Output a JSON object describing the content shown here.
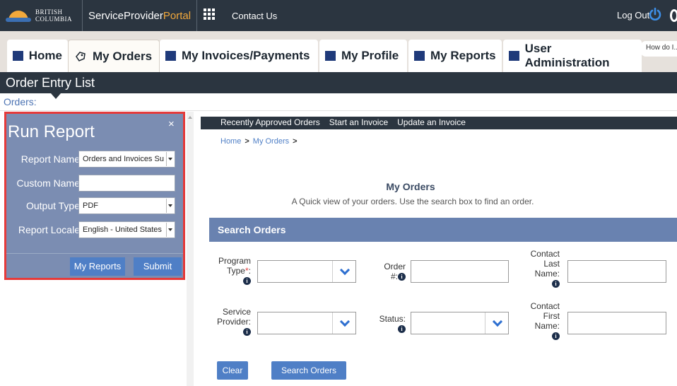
{
  "topbar": {
    "logo_line1": "BRITISH",
    "logo_line2": "COLUMBIA",
    "brand_part1": "ServiceProvider",
    "brand_part2": "Portal",
    "contact": "Contact Us",
    "logout": "Log Out"
  },
  "nav": {
    "tabs": [
      {
        "label": "Home",
        "icon": "square-icon"
      },
      {
        "label": "My Orders",
        "icon": "orders-icon"
      },
      {
        "label": "My Invoices/Payments",
        "icon": "square-icon"
      },
      {
        "label": "My Profile",
        "icon": "square-icon"
      },
      {
        "label": "My Reports",
        "icon": "square-icon"
      },
      {
        "label": "User Administration",
        "icon": "square-icon"
      }
    ],
    "help": "How do I..."
  },
  "titlebar": {
    "title": "Order Entry List"
  },
  "orders_label": "Orders:",
  "run_report": {
    "title": "Run Report",
    "close": "×",
    "fields": [
      {
        "label": "Report Name",
        "value": "Orders and Invoices Su"
      },
      {
        "label": "Custom Name",
        "value": ""
      },
      {
        "label": "Output Type",
        "value": "PDF"
      },
      {
        "label": "Report Locale",
        "value": "English - United States"
      }
    ],
    "my_reports_btn": "My Reports",
    "submit_btn": "Submit"
  },
  "subnav": {
    "items": [
      "Recently Approved Orders",
      "Start an Invoice",
      "Update an Invoice"
    ]
  },
  "breadcrumb": {
    "home": "Home",
    "sep": ">",
    "current": "My Orders"
  },
  "main": {
    "title": "My Orders",
    "subtitle": "A Quick view of your orders. Use the search box to find an order.",
    "search_header": "Search Orders",
    "fields": {
      "program_type_l1": "Program",
      "program_type_l2": "Type",
      "program_required": "*",
      "program_colon": ":",
      "order_l1": "Order",
      "order_l2": "#:",
      "contact_last_l1": "Contact",
      "contact_last_l2": "Last",
      "contact_last_l3": "Name:",
      "service_l1": "Service",
      "service_l2": "Provider:",
      "status": "Status:",
      "contact_first_l1": "Contact",
      "contact_first_l2": "First",
      "contact_first_l3": "Name:"
    },
    "clear_btn": "Clear",
    "search_btn": "Search Orders"
  },
  "colors": {
    "dark_bar": "#2b3540",
    "accent_orange": "#f2a83b",
    "nav_square": "#1f3a7a",
    "panel_blue": "#7b8db2",
    "button_blue": "#4f7fc6",
    "highlight_red": "#e53a3a"
  }
}
